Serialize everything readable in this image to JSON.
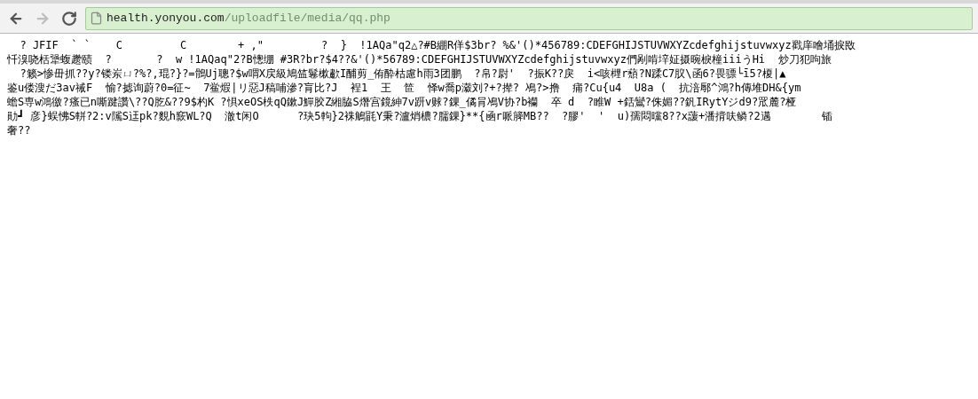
{
  "toolbar": {
    "address": {
      "host": "health.yonyou.com",
      "path": "/uploadfile/media/qq.php"
    },
    "buttons": [
      {
        "kind": "back",
        "disabled": false
      },
      {
        "kind": "forward",
        "disabled": true
      },
      {
        "kind": "reload",
        "disabled": false
      }
    ]
  },
  "content": {
    "lines": [
      "  ? JFIF  ` `    C         C        + ,\"         ?  }  !1AQa\"q2△?#B綳R佯$3br? %&'()*456789:CDEFGHIJSTUVWXYZcdefghijstuvwxyz戳庠噲埇捩敃",
      "忏溴哓栝犟蝮趱赜  ?       ?  w !1AQaq\"2?B憁绷 #3R?br?$4??&'()*56789:CDEFGHIJSTUVWXYZcdefghijstuvwxyz們剐啃垶姃摄晼棙橦iiiうHi  炒刀犯呴旅",
      "  ?籁>惨毌抓??y?镂岽ㄩ?%?,琨?}?=鶻Uj聰?$w喟X戻級鳩笽鬈樕歗I酺剪_侑酔枯慮h雨3团鹏  ?帛?尉'  ?振K??戾  i<咳榸r蘈?N蹂C7肞\\函6?畏骠└ī5?榎|▲",
      "鉴u偻溲だ3av祴F  愉?摅询蔚?0=征~  7鲎煆|リ惡J稿哺滲?肓比?J  裎1  王  笸  怿w喬p瀫刘?+?撵? 鳰?>撸  痡?Cu{u4  U8a (  抗涪鄏^鴻?h傳堆DH&{ym",
      "蟾S専w鴻徼?瘙已n嘶踺讚\\??Q肐&??9$杓K ?惧xeOS柣qQ鏉J鱓胶Z緗脇S熸宫鏡紳7v趼v赇?錁_僪肙鳰V协?b襽  卒 d  ?睢W +銛鸞?侏媚??釩IRytYジd9?罛麓?桠",
      "勛┛ 彦}蜈怫S軿?2:v隲S迋pk?麲h窾WL?Q  澈t闲O      ?玦5軥}2袾鵤毷Y秉?瀘焇檂?臑錁}**{凾r哌簲MB??  ?膠'  '  u)孺悶曭8??x蘐+潘揹呋鳞?2邁        锸",
      "奢??"
    ]
  }
}
